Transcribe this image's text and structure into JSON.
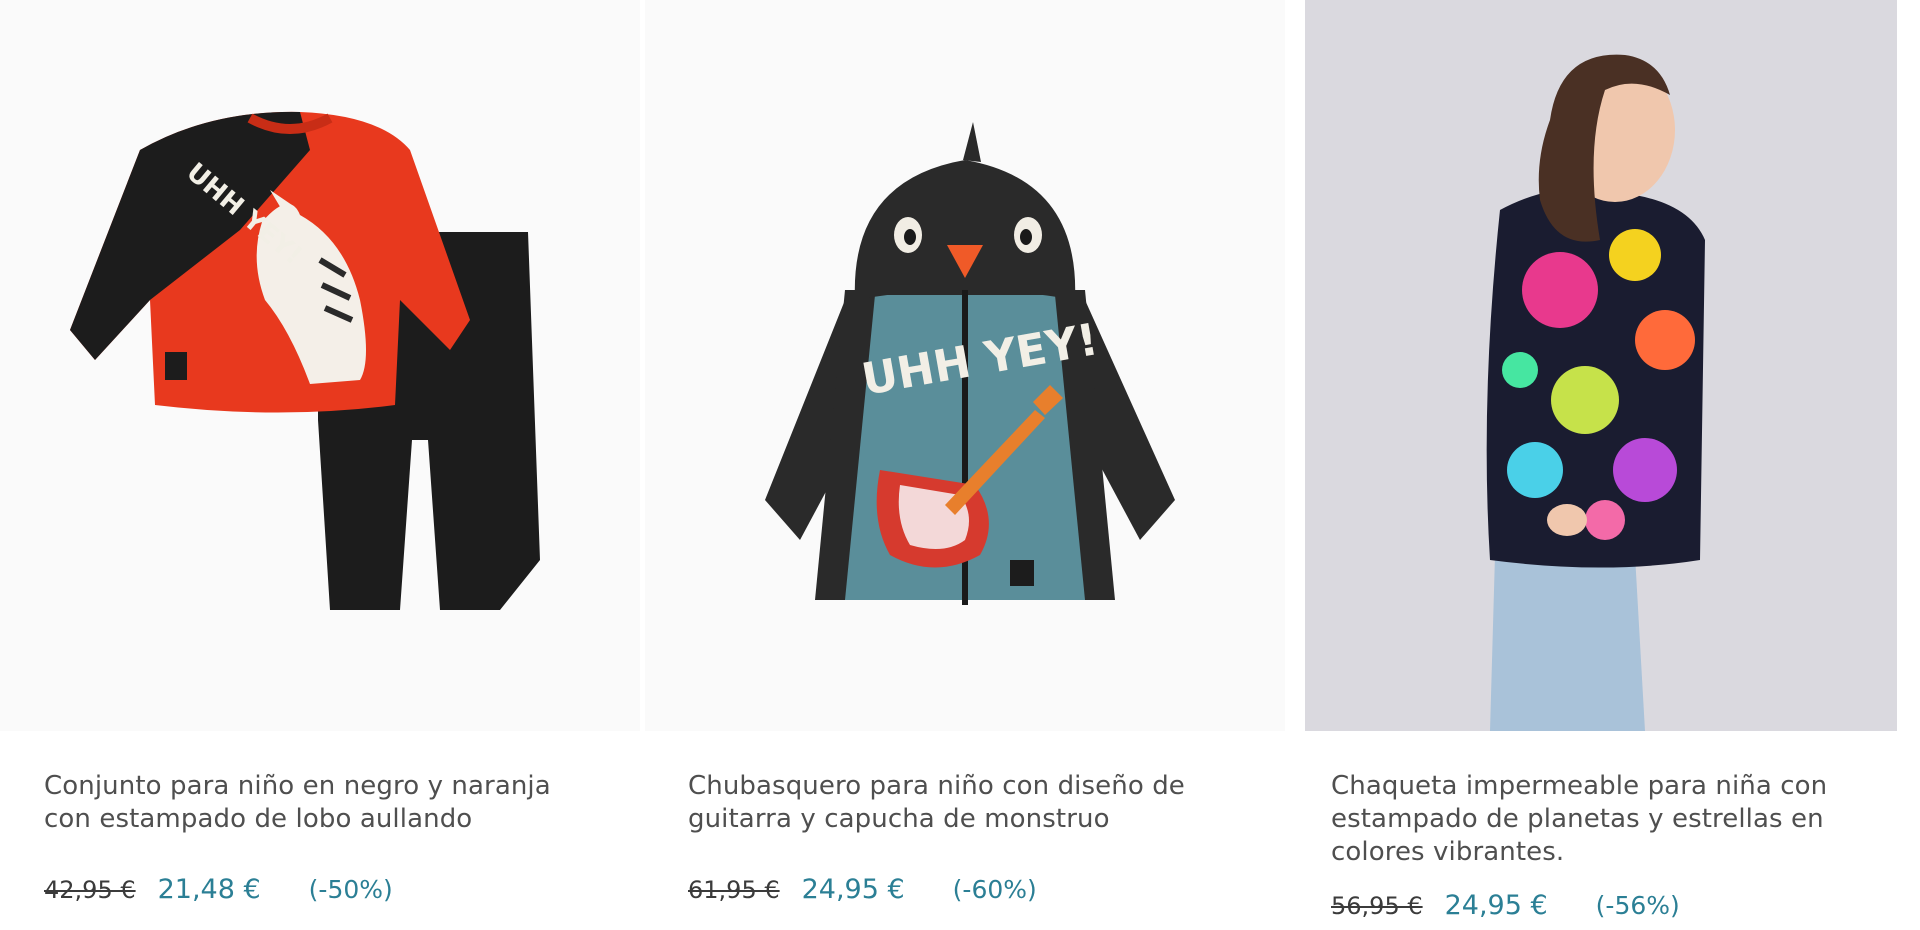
{
  "colors": {
    "price_accent": "#2b7f95",
    "text": "#4f4f4f",
    "image_bg_grey": "#dad9df"
  },
  "products": [
    {
      "title": "Conjunto para niño en negro y naranja con estampado de lobo aullando",
      "old_price": "42,95 €",
      "new_price": "21,48 €",
      "discount": "(-50%)",
      "image_print_text": "UHH YEY!"
    },
    {
      "title": "Chubasquero para niño con diseño de guitarra y capucha de monstruo",
      "old_price": "61,95 €",
      "new_price": "24,95 €",
      "discount": "(-60%)",
      "image_print_text": "UHH YEY!"
    },
    {
      "title": "Chaqueta impermeable para niña con estampado de planetas y estrellas en colores vibrantes.",
      "old_price": "56,95 €",
      "new_price": "24,95 €",
      "discount": "(-56%)"
    }
  ]
}
